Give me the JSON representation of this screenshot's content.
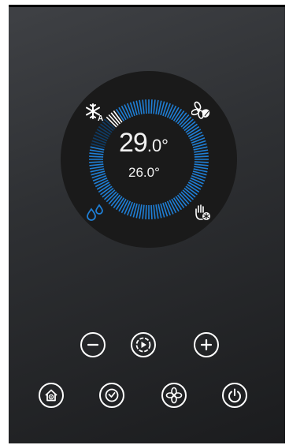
{
  "thermostat": {
    "set_temp_int": "29",
    "set_temp_dec": ".0°",
    "current_temp": "26.0°"
  },
  "dial": {
    "level": 0.92
  },
  "colors": {
    "accent": "#1f7fd6",
    "indicator": "#ffffff",
    "panel": "#2f3134",
    "dial": "#1a1a1a"
  },
  "mode_icons": [
    "snowflake-auto-icon",
    "fan-leaf-icon",
    "water-drop-icon",
    "hand-snowflake-icon"
  ],
  "controls": {
    "row1": [
      "minus-icon",
      "play-icon",
      "plus-icon"
    ],
    "row2": [
      "home-icon",
      "clock-icon",
      "fan-icon",
      "power-icon"
    ]
  }
}
